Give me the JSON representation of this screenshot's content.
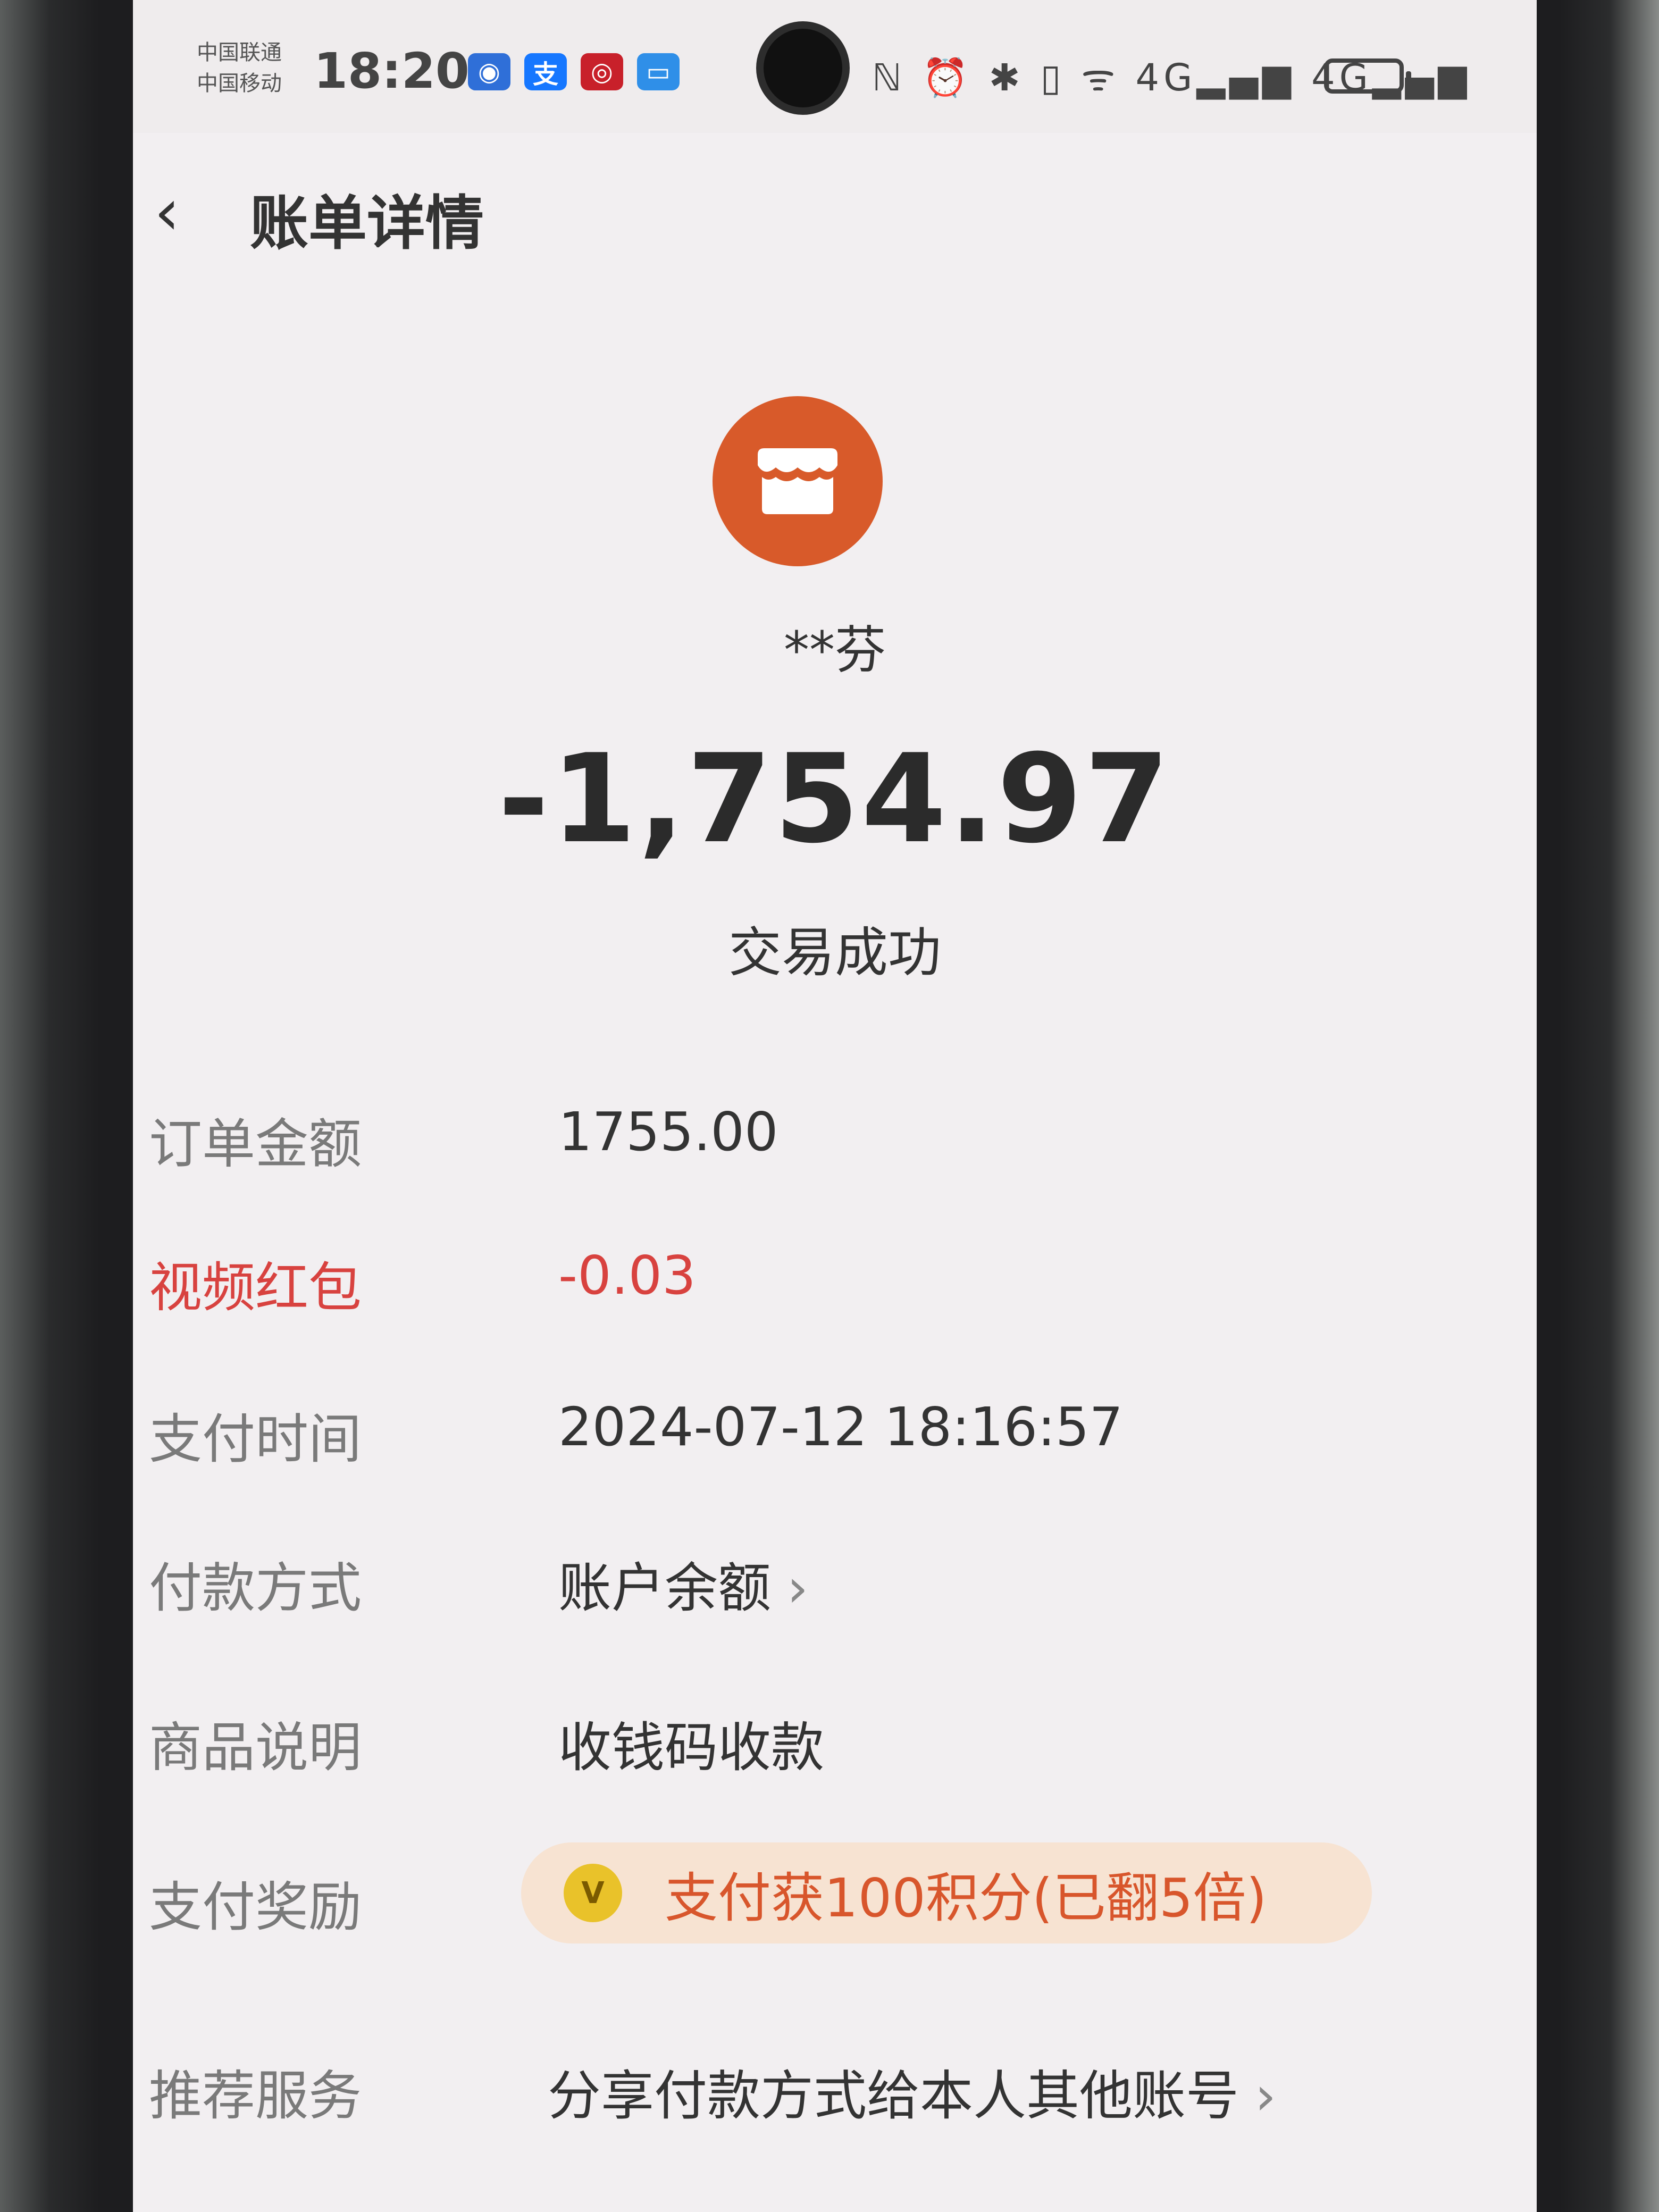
{
  "status_bar": {
    "carrier_1": "中国联通",
    "carrier_2": "中国移动",
    "time": "18:20",
    "notif_icons": [
      {
        "glyph": "◉",
        "color": "#2f6fd8"
      },
      {
        "glyph": "支",
        "color": "#1677ff"
      },
      {
        "glyph": "◎",
        "color": "#c8202a"
      },
      {
        "glyph": "▭",
        "color": "#2f8fe8"
      }
    ],
    "system_icons": "ℕ ⏰ ✱ ▯ ᯤ 4G▂▄▆ 4G▂▄▆"
  },
  "header": {
    "back_icon": "‹",
    "title": "账单详情"
  },
  "merchant": {
    "name": "**芬",
    "logo_color": "#d85a2a"
  },
  "transaction": {
    "amount": "-1,754.97",
    "status": "交易成功"
  },
  "details": {
    "order_amount_label": "订单金额",
    "order_amount_value": "1755.00",
    "video_redpacket_label": "视频红包",
    "video_redpacket_value": "-0.03",
    "pay_time_label": "支付时间",
    "pay_time_value": "2024-07-12 18:16:57",
    "pay_method_label": "付款方式",
    "pay_method_value": "账户余额",
    "product_desc_label": "商品说明",
    "product_desc_value": "收钱码收款",
    "reward_label": "支付奖励",
    "reward_coin": "V",
    "reward_value": "支付获100积分(已翻5倍)",
    "recommend_label": "推荐服务",
    "recommend_value": "分享付款方式给本人其他账号",
    "chevron": "›"
  }
}
